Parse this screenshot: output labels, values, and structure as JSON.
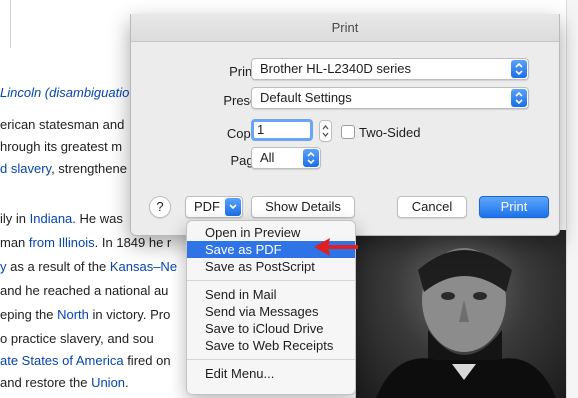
{
  "background_page": {
    "lines": [
      {
        "segments": [
          {
            "text": "Lincoln (disambiguatio",
            "style": "link-italic"
          }
        ]
      },
      {
        "segments": [
          {
            "text": "erican statesman and",
            "style": "text"
          }
        ]
      },
      {
        "segments": [
          {
            "text": "hrough its greatest m",
            "style": "text"
          }
        ]
      },
      {
        "segments": [
          {
            "text": "d slavery",
            "style": "link"
          },
          {
            "text": ", strengthene",
            "style": "text"
          }
        ]
      },
      {
        "segments": [
          {
            "text": "ily in ",
            "style": "text"
          },
          {
            "text": "Indiana",
            "style": "link"
          },
          {
            "text": ". He was",
            "style": "text"
          }
        ]
      },
      {
        "segments": [
          {
            "text": "man ",
            "style": "text"
          },
          {
            "text": "from Illinois",
            "style": "link"
          },
          {
            "text": ". In 1849 he r",
            "style": "text"
          }
        ]
      },
      {
        "segments": [
          {
            "text": "y",
            "style": "link"
          },
          {
            "text": " as a result of the ",
            "style": "text"
          },
          {
            "text": "Kansas–Ne",
            "style": "link"
          }
        ]
      },
      {
        "segments": [
          {
            "text": "and he reached a national au",
            "style": "text"
          }
        ]
      },
      {
        "segments": [
          {
            "text": "eping the ",
            "style": "text"
          },
          {
            "text": "North",
            "style": "link"
          },
          {
            "text": " in victory. Pro",
            "style": "text"
          }
        ]
      },
      {
        "segments": [
          {
            "text": "o practice slavery, and sou",
            "style": "text"
          }
        ]
      },
      {
        "segments": [
          {
            "text": "ate States of America",
            "style": "link"
          },
          {
            "text": " fired on",
            "style": "text"
          }
        ]
      },
      {
        "segments": [
          {
            "text": "and restore the ",
            "style": "text"
          },
          {
            "text": "Union",
            "style": "link"
          },
          {
            "text": ".",
            "style": "text"
          }
        ]
      }
    ]
  },
  "dialog": {
    "title": "Print",
    "printer_label": "Printer:",
    "printer_value": "Brother HL-L2340D series",
    "presets_label": "Presets:",
    "presets_value": "Default Settings",
    "copies_label": "Copies:",
    "copies_value": "1",
    "two_sided_label": "Two-Sided",
    "pages_label": "Pages:",
    "pages_value": "All",
    "help_label": "?",
    "pdf_label": "PDF",
    "show_details_label": "Show Details",
    "cancel_label": "Cancel",
    "print_label": "Print",
    "accent_color": "#1c72ea"
  },
  "pdf_menu": {
    "groups": [
      [
        "Open in Preview",
        "Save as PDF",
        "Save as PostScript"
      ],
      [
        "Send in Mail",
        "Send via Messages",
        "Save to iCloud Drive",
        "Save to Web Receipts"
      ],
      [
        "Edit Menu..."
      ]
    ],
    "selected": "Save as PDF",
    "highlight_color": "#2f74e6"
  },
  "annotation": {
    "arrow_color": "#e02020",
    "icon": "red-arrow-icon"
  }
}
